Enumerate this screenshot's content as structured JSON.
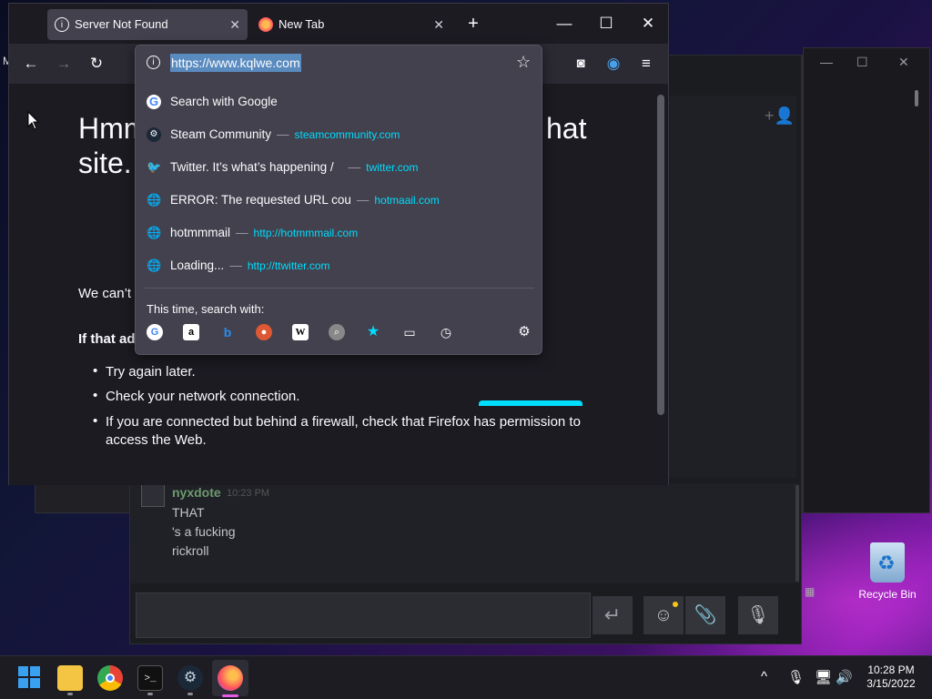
{
  "firefox": {
    "tabs": [
      {
        "label": "Server Not Found",
        "active": true
      },
      {
        "label": "New Tab",
        "active": false
      }
    ],
    "new_tab_symbol": "+",
    "window_controls": {
      "minimize": "—",
      "maximize": "☐",
      "close": "✕"
    },
    "url": "https://www.kqlwe.com",
    "error_page": {
      "title_line1_left": "Hmm",
      "title_line1_right": "hat",
      "title_line2": "site.",
      "paragraph": "We can’t c",
      "advice_heading": "If that ad",
      "bullets": [
        "Try again later.",
        "Check your network connection.",
        "If you are connected but behind a firewall, check that Firefox has permission to access the Web."
      ]
    },
    "url_suggestions": [
      {
        "icon": "google-icon",
        "title": "Search with Google",
        "url": ""
      },
      {
        "icon": "steam-icon",
        "title": "Steam Community",
        "url": "steamcommunity.com"
      },
      {
        "icon": "twitter-icon",
        "title": "Twitter. It’s what’s happening /",
        "url": "twitter.com"
      },
      {
        "icon": "globe-icon",
        "title": "ERROR: The requested URL cou",
        "url": "hotmaail.com"
      },
      {
        "icon": "globe-icon",
        "title": "hotmmmail",
        "url": "http://hotmmmail.com"
      },
      {
        "icon": "globe-icon",
        "title": "Loading...",
        "url": "http://ttwitter.com"
      }
    ],
    "separator": "—",
    "search_with_label": "This time, search with:",
    "search_engines": [
      "google-icon",
      "amazon-icon",
      "bing-icon",
      "duckduckgo-icon",
      "wikipedia-icon",
      "search-icon",
      "bookmarks-star-icon",
      "tabs-icon",
      "history-icon",
      "settings-gear-icon"
    ]
  },
  "steam_chat": {
    "username": "nyxdote",
    "timestamp": "10:23 PM",
    "messages": [
      "THAT",
      "'s a fucking",
      "rickroll"
    ],
    "send_symbol": "↵"
  },
  "desktop": {
    "recycle_bin_label": "Recycle Bin",
    "left_fragment": "M"
  },
  "taskbar": {
    "apps": [
      "windows-start-icon",
      "file-explorer-icon",
      "chrome-icon",
      "terminal-icon",
      "steam-icon",
      "firefox-icon"
    ],
    "time": "10:28 PM",
    "date": "3/15/2022"
  }
}
